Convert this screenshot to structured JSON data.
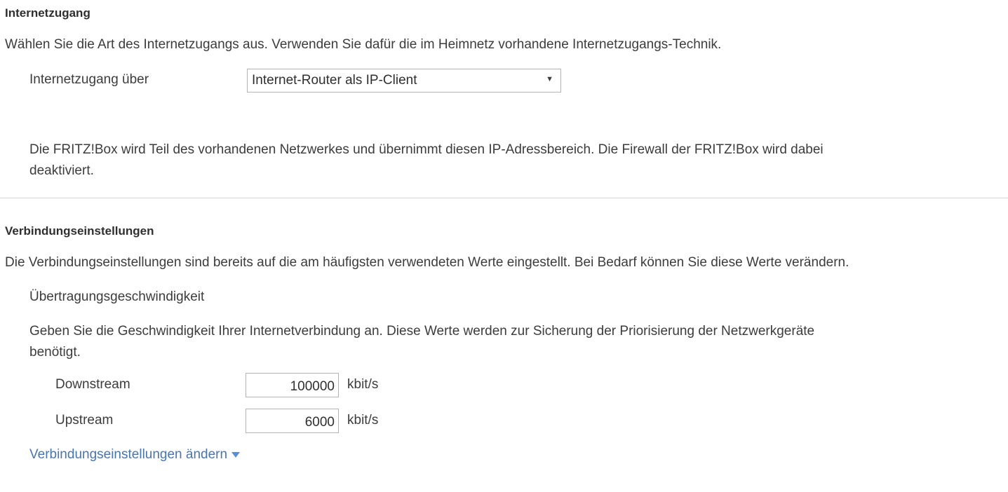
{
  "internet_section": {
    "heading": "Internetzugang",
    "description": "Wählen Sie die Art des Internetzugangs aus. Verwenden Sie dafür die im Heimnetz vorhandene Internetzugangs-Technik.",
    "access_label": "Internetzugang über",
    "access_select": {
      "selected": "Internet-Router als IP-Client",
      "arrow": "▼"
    },
    "info_line1": "Die FRITZ!Box wird Teil des vorhandenen Netzwerkes und übernimmt diesen IP-Adressbereich. Die Firewall der FRITZ!Box wird dabei",
    "info_line2": "deaktiviert."
  },
  "connection_section": {
    "heading": "Verbindungseinstellungen",
    "description": "Die Verbindungseinstellungen sind bereits auf die am häufigsten verwendeten Werte eingestellt. Bei Bedarf können Sie diese Werte verändern.",
    "speed_title": "Übertragungsgeschwindigkeit",
    "speed_desc_line1": "Geben Sie die Geschwindigkeit Ihrer Internetverbindung an. Diese Werte werden zur Sicherung der Priorisierung der Netzwerkgeräte",
    "speed_desc_line2": "benötigt.",
    "downstream": {
      "label": "Downstream",
      "value": "100000",
      "unit": "kbit/s"
    },
    "upstream": {
      "label": "Upstream",
      "value": "6000",
      "unit": "kbit/s"
    },
    "change_link": "Verbindungseinstellungen ändern"
  },
  "colors": {
    "link": "#4a75ad",
    "link_arrow": "#5b8ed0",
    "divider": "#d6d6d6",
    "field_border": "#b4b4b4"
  }
}
